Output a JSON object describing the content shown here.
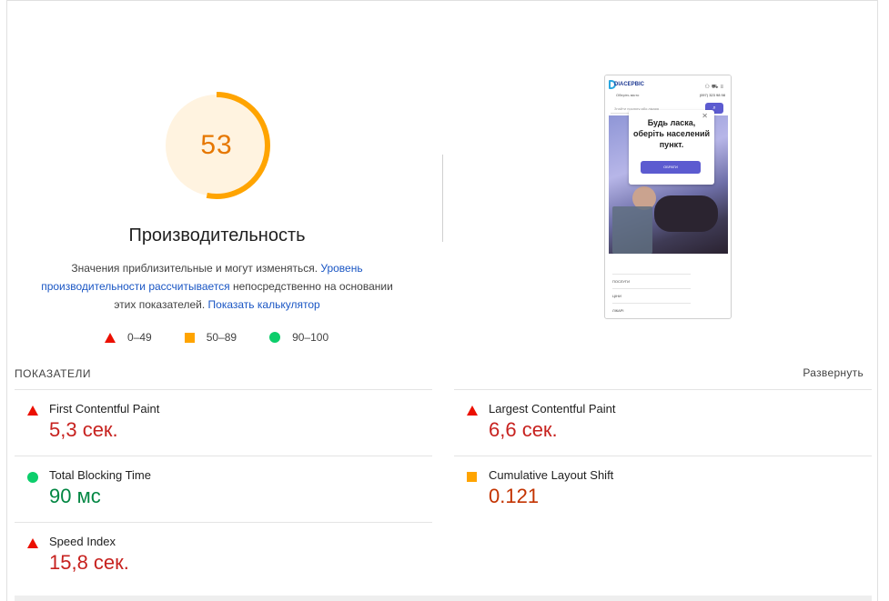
{
  "gauge": {
    "score": "53",
    "score_fraction": 0.53,
    "title": "Производительность",
    "color": "#ffa400",
    "desc_part1": "Значения приблизительные и могут изменяться. ",
    "desc_link1": "Уровень производительности рассчитывается",
    "desc_part2": " непосредственно на основании этих показателей. ",
    "desc_link2": "Показать калькулятор"
  },
  "legend": [
    {
      "icon": "triangle",
      "label": "0–49"
    },
    {
      "icon": "square",
      "label": "50–89"
    },
    {
      "icon": "circle",
      "label": "90–100"
    }
  ],
  "phone": {
    "logo": "DIACEPBIC",
    "location": "Оберіть місто",
    "phone_number": "(097) 323 98 98",
    "search_placeholder": "Знайти послугу або лікаря",
    "popup_text": "Будь ласка, оберіть населений пункт.",
    "popup_button": "ОБРАТИ",
    "menu": [
      "ПОСЛУГИ",
      "ЦІНИ",
      "ЛІКАРІ"
    ]
  },
  "metrics": {
    "heading": "ПОКАЗАТЕЛИ",
    "expand_label": "Развернуть",
    "items": [
      {
        "name": "First Contentful Paint",
        "value": "5,3 сек.",
        "status": "fail"
      },
      {
        "name": "Largest Contentful Paint",
        "value": "6,6 сек.",
        "status": "fail"
      },
      {
        "name": "Total Blocking Time",
        "value": "90 мс",
        "status": "pass"
      },
      {
        "name": "Cumulative Layout Shift",
        "value": "0.121",
        "status": "average"
      },
      {
        "name": "Speed Index",
        "value": "15,8 сек.",
        "status": "fail"
      }
    ]
  },
  "colors": {
    "fail": "#eb0f00",
    "average": "#ffa400",
    "pass": "#0cce6b",
    "link": "#1a56c4"
  }
}
